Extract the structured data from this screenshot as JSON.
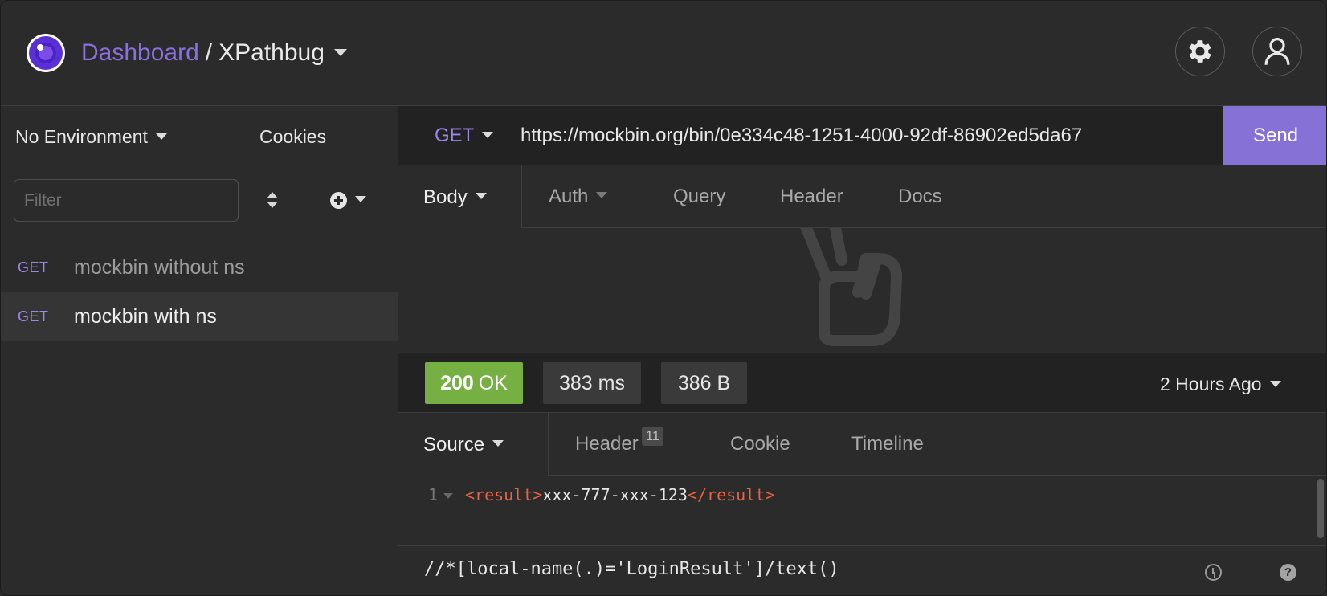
{
  "header": {
    "dashboard_label": "Dashboard",
    "separator": "/",
    "project_name": "XPathbug",
    "icons": [
      "logo-icon",
      "gear-icon",
      "user-icon"
    ]
  },
  "sidebar": {
    "environment": "No Environment",
    "cookies": "Cookies",
    "filter_placeholder": "Filter",
    "requests": [
      {
        "method": "GET",
        "name": "mockbin without ns",
        "active": false
      },
      {
        "method": "GET",
        "name": "mockbin with ns",
        "active": true
      }
    ]
  },
  "request": {
    "method": "GET",
    "url": "https://mockbin.org/bin/0e334c48-1251-4000-92df-86902ed5da67",
    "send_label": "Send",
    "tabs": [
      "Body",
      "Auth",
      "Query",
      "Header",
      "Docs"
    ]
  },
  "response": {
    "status_code": "200",
    "status_text": "OK",
    "time": "383 ms",
    "size": "386 B",
    "when": "2 Hours Ago",
    "tabs": [
      "Source",
      "Header",
      "Cookie",
      "Timeline"
    ],
    "header_count": "11",
    "code": {
      "line_number": "1",
      "open_tag": "<result>",
      "content": "xxx-777-xxx-123",
      "close_tag": "</result>"
    },
    "xpath_query": "//*[local-name(.)='LoginResult']/text()",
    "help_glyph": "?"
  },
  "colors": {
    "accent": "#8672d7",
    "method": "#9b87e8",
    "status_ok": "#76b043",
    "xml_tag": "#e9623f",
    "background": "#2b2b2b"
  }
}
